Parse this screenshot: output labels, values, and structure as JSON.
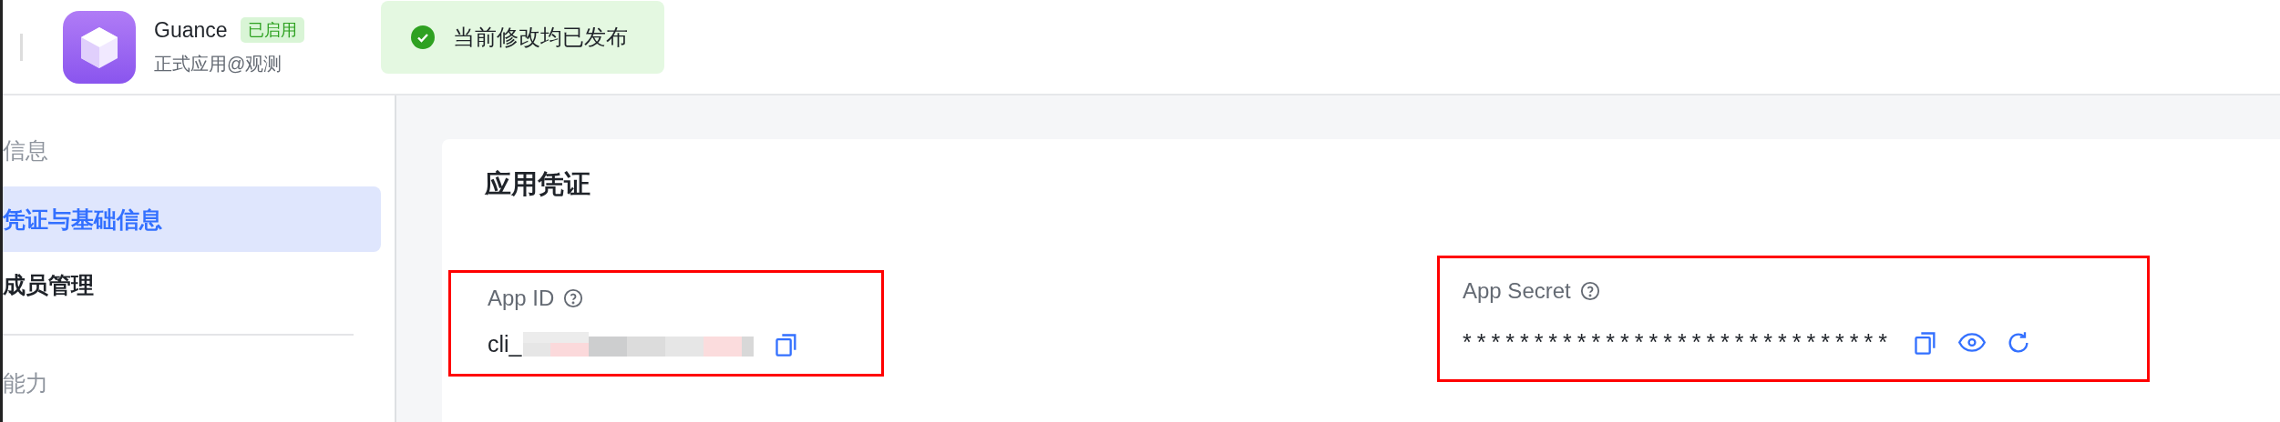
{
  "header": {
    "app_name": "Guance",
    "status_badge": "已启用",
    "subtitle": "正式应用@观测"
  },
  "toast": {
    "message": "当前修改均已发布"
  },
  "sidebar": {
    "items": [
      {
        "kind": "group",
        "label": "信息",
        "selected": false
      },
      {
        "kind": "item",
        "label": "凭证与基础信息",
        "selected": true
      },
      {
        "kind": "item",
        "label": "成员管理",
        "selected": false
      },
      {
        "kind": "divider"
      },
      {
        "kind": "group",
        "label": "能力",
        "selected": false
      }
    ]
  },
  "card": {
    "title": "应用凭证",
    "fields": [
      {
        "label": "App ID",
        "value": "cli_",
        "redacted": true,
        "actions": [
          {
            "kind": "copy"
          }
        ]
      },
      {
        "label": "App Secret",
        "value": "******************************",
        "redacted": false,
        "actions": [
          {
            "kind": "copy"
          },
          {
            "kind": "view"
          },
          {
            "kind": "refresh"
          }
        ]
      }
    ]
  }
}
